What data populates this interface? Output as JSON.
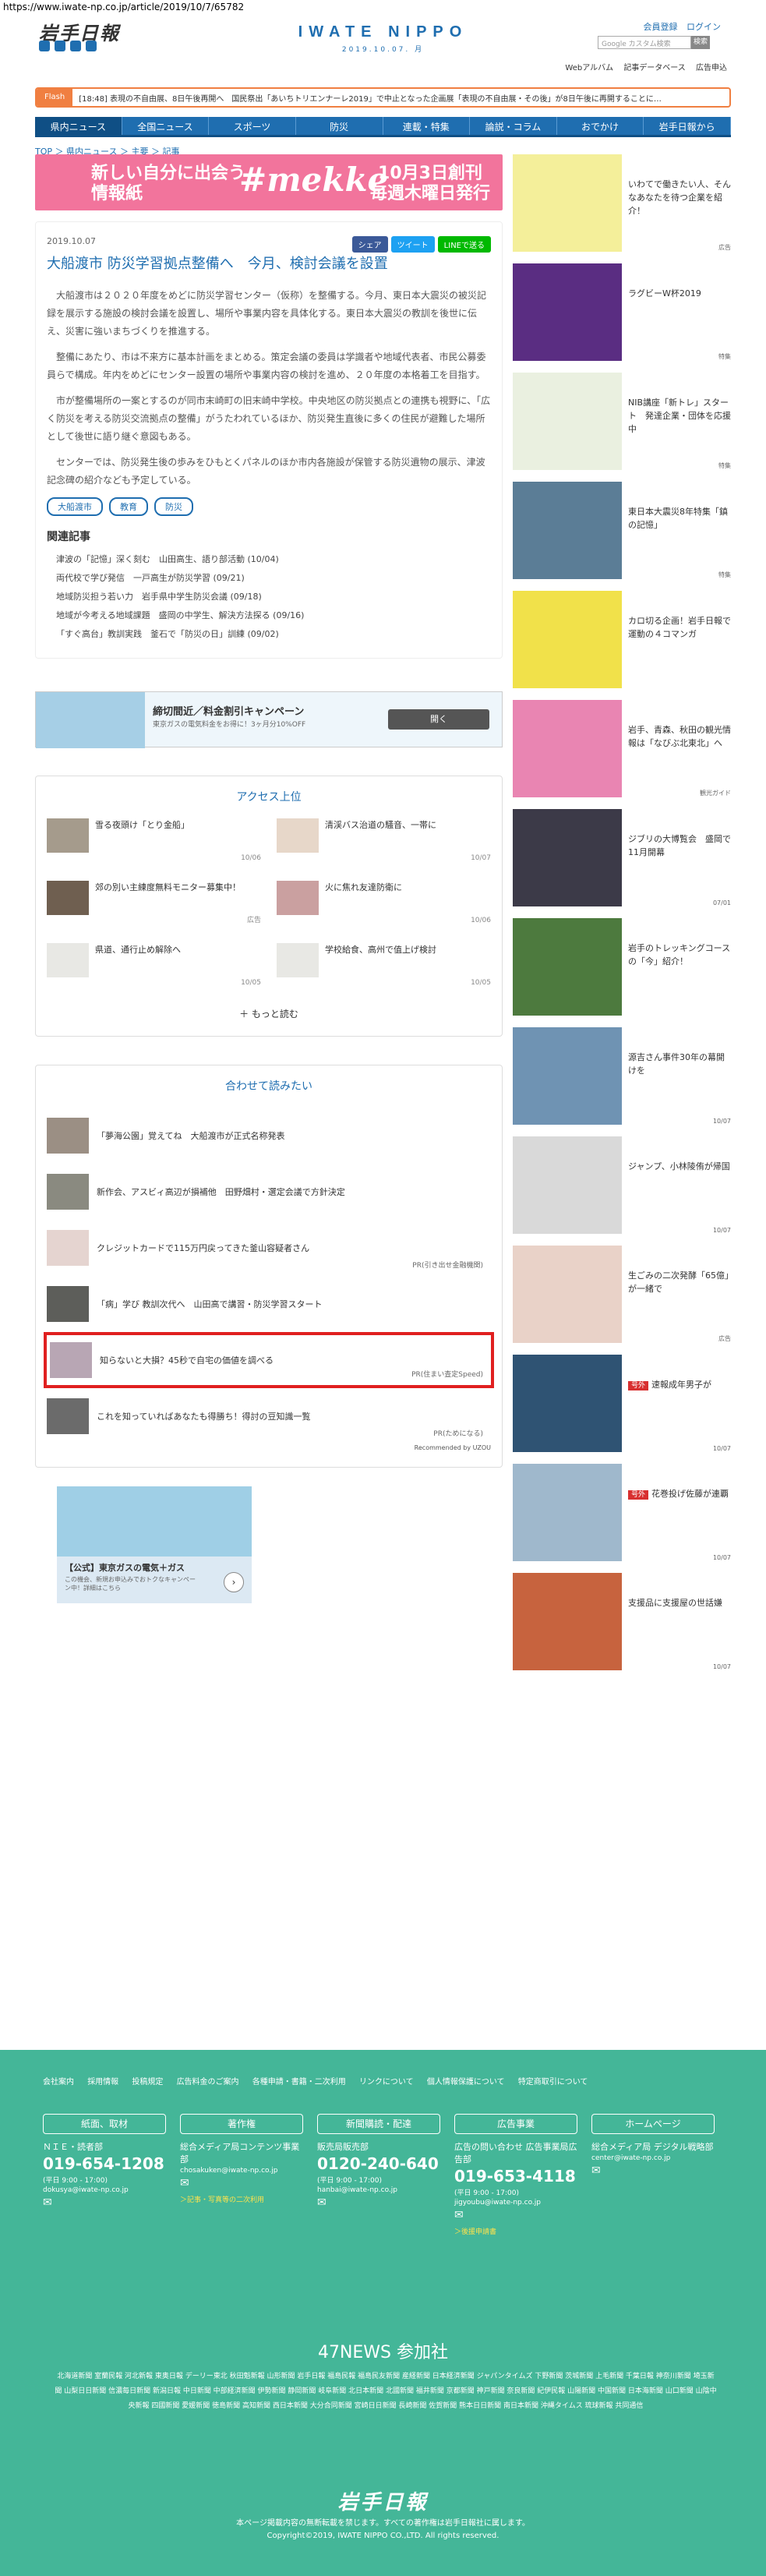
{
  "url": "https://www.iwate-np.co.jp/article/2019/10/7/65782",
  "header": {
    "logo_jp": "岩手日報",
    "logo_en": "IWATE NIPPO",
    "date": "2019.10.07. 月",
    "links": [
      "会員登録",
      "ログイン"
    ],
    "search_placeholder": "Google カスタム検索",
    "search_btn": "検索",
    "sublinks": [
      "Webアルバム",
      "記事データベース",
      "広告申込"
    ]
  },
  "flash": {
    "tag": "Flash",
    "text": "[18:48] 表現の不自由展、8日午後再開へ　国民祭出「あいちトリエンナーレ2019」で中止となった企画展「表現の不自由展・その後」が8日午後に再開することに…"
  },
  "nav": [
    "県内ニュース",
    "全国ニュース",
    "スポーツ",
    "防災",
    "連載・特集",
    "論説・コラム",
    "おでかけ",
    "岩手日報から"
  ],
  "breadcrumb": "TOP ＞ 県内ニュース ＞ 主要 ＞ 記事",
  "banner": {
    "left": "新しい自分に出会う\n情報紙",
    "mid": "#mekke",
    "right": "10月3日創刊\n毎週木曜日発行"
  },
  "article": {
    "date": "2019.10.07",
    "share": [
      "シェア",
      "ツイート",
      "LINEで送る"
    ],
    "title": "大船渡市 防災学習拠点整備へ　今月、検討会議を設置",
    "paras": [
      "大船渡市は２０２０年度をめどに防災学習センター（仮称）を整備する。今月、東日本大震災の被災記録を展示する施設の検討会議を設置し、場所や事業内容を具体化する。東日本大震災の教訓を後世に伝え、災害に強いまちづくりを推進する。",
      "整備にあたり、市は不来方に基本計画をまとめる。策定会議の委員は学識者や地域代表者、市民公募委員らで構成。年内をめどにセンター設置の場所や事業内容の検討を進め、２０年度の本格着工を目指す。",
      "市が整備場所の一案とするのが同市末崎町の旧末崎中学校。中央地区の防災拠点との連携も視野に、「広く防災を考える防災交流拠点の整備」がうたわれているほか、防災発生直後に多くの住民が避難した場所として後世に語り継ぐ意図もある。",
      "センターでは、防災発生後の歩みをひもとくパネルのほか市内各施設が保管する防災遺物の展示、津波記念碑の紹介なども予定している。"
    ],
    "tags": [
      "大船渡市",
      "教育",
      "防災"
    ],
    "related_title": "関連記事",
    "related": [
      "津波の「記憶」深く刻む　山田高生、語り部活動 (10/04)",
      "両代校で学び発信　一戸高生が防災学習 (09/21)",
      "地域防災担う若い力　岩手県中学生防災会議 (09/18)",
      "地域が今考える地域課題　盛岡の中学生、解決方法探る (09/16)",
      "「すぐ高台」教訓実践　釜石で「防災の日」訓練 (09/02)"
    ]
  },
  "ad1": {
    "title": "締切間近／料金割引キャンペーン",
    "text": "東京ガスの電気料金をお得に！3ヶ月分10%OFF",
    "btn": "開く"
  },
  "access": {
    "title": "アクセス上位",
    "items": [
      {
        "t": "雪る夜頭け「とり金船」",
        "d": "10/06"
      },
      {
        "t": "清渓バス治道の騒音、一帯に",
        "d": "10/07"
      },
      {
        "t": "郊の別い主練度無料モニター募集中！",
        "d": "広告"
      },
      {
        "t": "火に焦れ友達防衛に",
        "d": "10/06"
      },
      {
        "t": "県道、通行止め解除へ",
        "d": "10/05"
      },
      {
        "t": "学校給食、高州で值上げ検討",
        "d": "10/05"
      }
    ],
    "more": "もっと読む"
  },
  "related2": {
    "title": "合わせて読みたい",
    "items": [
      {
        "t": "「夢海公園」覚えてね　大船渡市が正式名称発表",
        "pr": ""
      },
      {
        "t": "新作会、アスビィ高辺が損補他　田野畑村・選定会議で方針決定",
        "pr": ""
      },
      {
        "t": "クレジットカードで115万円戻ってきた釜山容疑者さん",
        "pr": "PR(引き出せ金融機関)"
      },
      {
        "t": "「病」学び 教訓次代へ　山田高で講習・防災学習スタート",
        "pr": ""
      },
      {
        "t": "知らないと大損？45秒で自宅の価値を調べる",
        "pr": "PR(住まい査定Speed)"
      },
      {
        "t": "これを知っていればあなたも得勝ち！得討の豆知識一覧",
        "pr": "PR(ためになる)"
      }
    ],
    "recommended": "Recommended by UZOU"
  },
  "ad2": {
    "title": "【公式】東京ガスの電気＋ガス",
    "text": "この機会、新規お申込みでおトクなキャンペーン中！詳細はこちら"
  },
  "sidebar": [
    {
      "t": "いわてで働きたい人、そんなあなたを待つ企業を紹介！",
      "d": "広告",
      "c": "#f4ef9a"
    },
    {
      "t": "ラグビーW杯2019",
      "d": "特集",
      "c": "#5a2d82"
    },
    {
      "t": "NIB講座「新トレ」スタート　発達企業・団体を応援中",
      "d": "特集",
      "c": "#eaf0e0"
    },
    {
      "t": "東日本大震災8年特集「鎮の記憶」",
      "d": "特集",
      "c": "#5b7d96"
    },
    {
      "t": "カロ切る企画！岩手日報で運動の４コマンガ",
      "d": "",
      "c": "#f1e14a"
    },
    {
      "t": "岩手、青森、秋田の観光情報は「なびぶ北東北」へ",
      "d": "観光ガイド",
      "c": "#e985b2"
    },
    {
      "t": "ジブリの大博覧会　盛岡で11月開幕",
      "d": "07/01",
      "c": "#3c3a48"
    },
    {
      "t": "岩手のトレッキングコースの「今」紹介！",
      "d": "",
      "c": "#4d7a3e"
    },
    {
      "t": "源吉さん事件30年の幕開けを",
      "d": "10/07",
      "c": "#6f93b3"
    },
    {
      "t": "ジャンプ、小林陵侑が帰国",
      "d": "10/07",
      "c": "#d9d9d9"
    },
    {
      "t": "生ごみの二次発酵「65億」が一緒で",
      "d": "広告",
      "c": "#e9d2c8"
    },
    {
      "t": "速報成年男子が",
      "d": "10/07",
      "c": "#2f5373",
      "hot": "号外"
    },
    {
      "t": "花巻投げ佐藤が連覇",
      "d": "10/07",
      "c": "#9fb8cc",
      "hot": "号外"
    },
    {
      "t": "支援品に支援屋の世話嫌",
      "d": "10/07",
      "c": "#c7633e"
    }
  ],
  "footer": {
    "links": [
      "会社案内",
      "採用情報",
      "投稿規定",
      "広告料金のご案内",
      "各種申請・書籍・二次利用",
      "リンクについて",
      "個人情報保護について",
      "特定商取引について"
    ],
    "cols": [
      {
        "h": "紙面、取材",
        "a": "ＮＩＥ・読者部",
        "tel": "019-654-1208",
        "m": "(平日 9:00 - 17:00)",
        "mail": "dokusya@iwate-np.co.jp"
      },
      {
        "h": "著作権",
        "a": "総合メディア局コンテンツ事業部",
        "tel": "",
        "m": "",
        "mail": "chosakuken@iwate-np.co.jp",
        "y": "＞記事・写真等の二次利用"
      },
      {
        "h": "新聞購読・配達",
        "a": "販売局販売部",
        "tel": "0120-240-640",
        "m": "(平日 9:00 - 17:00)",
        "mail": "hanbai@iwate-np.co.jp"
      },
      {
        "h": "広告事業",
        "a": "広告の問い合わせ 広告事業局広告部",
        "tel": "019-653-4118",
        "m": "(平日 9:00 - 17:00)",
        "mail": "jigyoubu@iwate-np.co.jp",
        "y": "＞後援申請書"
      },
      {
        "h": "ホームページ",
        "a": "総合メディア局 デジタル戦略部",
        "tel": "",
        "m": "",
        "mail": "center@iwate-np.co.jp"
      }
    ],
    "title47": "47NEWS 参加社",
    "papers": "北海道新聞 室蘭民報 河北新報 東奥日報 デーリー東北 秋田魁新報 山形新聞 岩手日報 福島民報 福島民友新聞 産経新聞 日本経済新聞 ジャパンタイムズ 下野新聞 茨城新聞 上毛新聞 千葉日報 神奈川新聞 埼玉新聞 山梨日日新聞 信濃毎日新聞 新潟日報 中日新聞 中部経済新聞 伊勢新聞 静岡新聞 岐阜新聞 北日本新聞 北國新聞 福井新聞 京都新聞 神戸新聞 奈良新聞 紀伊民報 山陽新聞 中国新聞 日本海新聞 山口新聞 山陰中央新報 四國新聞 愛媛新聞 徳島新聞 高知新聞 西日本新聞 大分合同新聞 宮崎日日新聞 長崎新聞 佐賀新聞 熊本日日新聞 南日本新聞 沖縄タイムス 琉球新報 共同通信",
    "logo": "岩手日報",
    "copy1": "本ページ掲載内容の無断転載を禁じます。すべての著作権は岩手日報社に属します。",
    "copy2": "Copyright©2019, IWATE NIPPO CO.,LTD. All rights reserved."
  }
}
